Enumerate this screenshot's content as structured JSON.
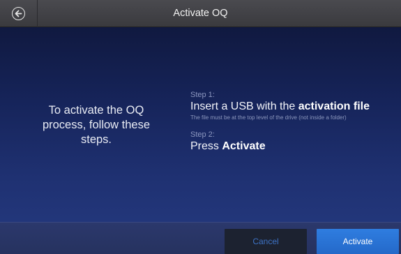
{
  "header": {
    "title": "Activate OQ",
    "back_icon": "arrow-left-circle-icon"
  },
  "intro": {
    "text": "To activate the OQ process, follow these steps."
  },
  "steps": [
    {
      "label": "Step 1:",
      "text_prefix": "Insert a USB with the ",
      "text_bold": "activation file",
      "note": "The file must be at the top level of the drive (not inside a folder)"
    },
    {
      "label": "Step 2:",
      "text_prefix": "Press ",
      "text_bold": "Activate"
    }
  ],
  "footer": {
    "cancel_label": "Cancel",
    "activate_label": "Activate"
  },
  "colors": {
    "accent_blue": "#2a74d6",
    "cancel_text": "#3d72c4",
    "header_bg": "#3f3f43"
  }
}
